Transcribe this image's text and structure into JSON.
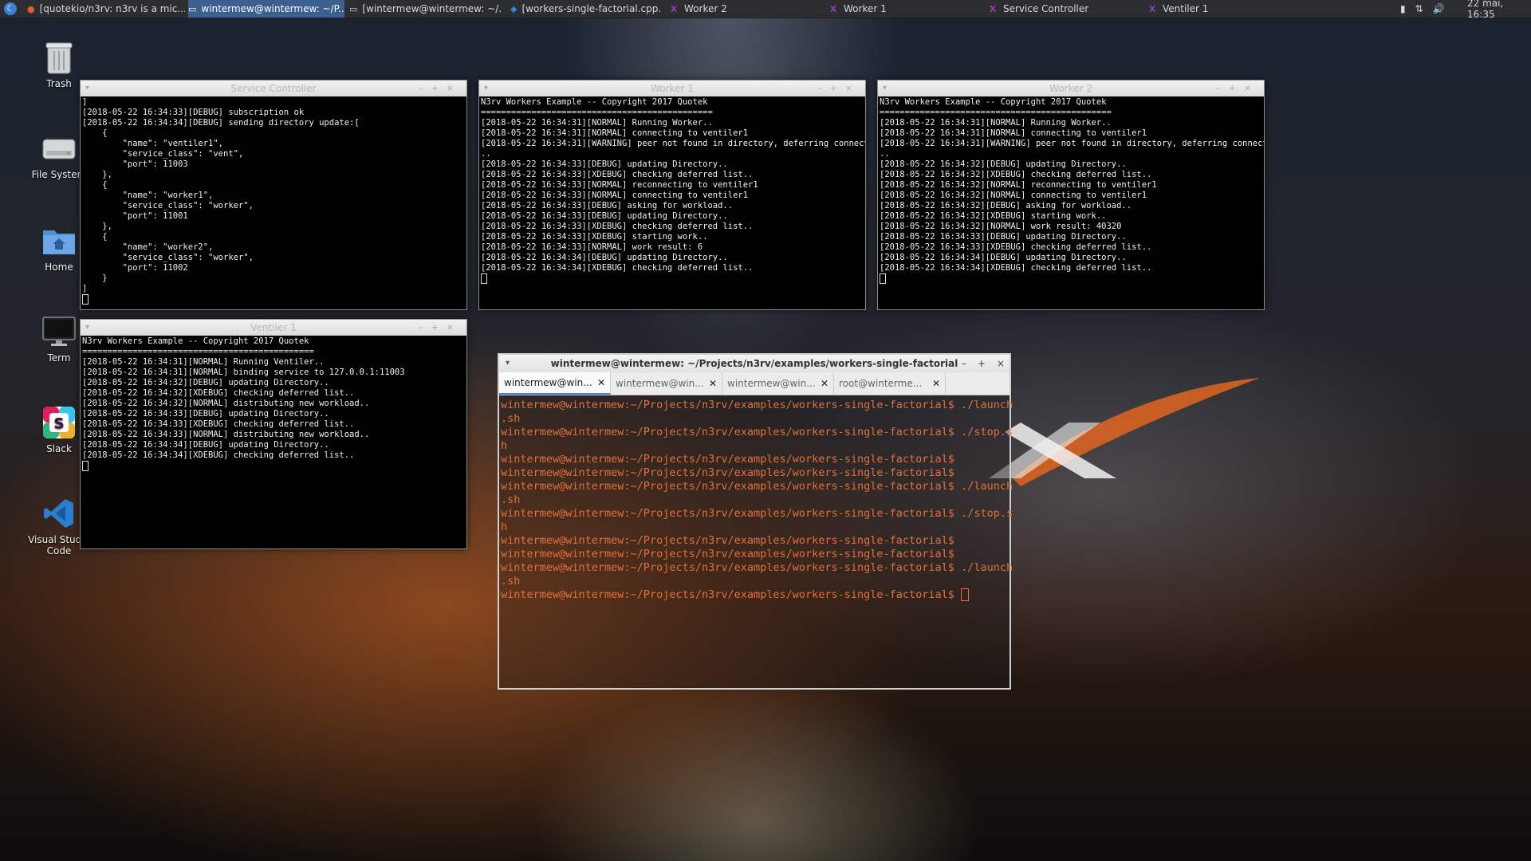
{
  "taskbar": {
    "tasks": [
      {
        "label": "[quotekio/n3rv: n3rv is a mic..."
      },
      {
        "label": "wintermew@wintermew: ~/P..."
      },
      {
        "label": "[wintermew@wintermew: ~/..."
      },
      {
        "label": "[workers-single-factorial.cpp..."
      },
      {
        "label": "Worker 2"
      },
      {
        "label": "Worker 1"
      },
      {
        "label": "Service Controller"
      },
      {
        "label": "Ventiler 1"
      }
    ],
    "clock": "22 mai, 16:35"
  },
  "desktop": {
    "icons": [
      {
        "label": "Trash"
      },
      {
        "label": "File System"
      },
      {
        "label": "Home"
      },
      {
        "label": "Term"
      },
      {
        "label": "Slack"
      },
      {
        "label": "Visual Studio Code"
      }
    ]
  },
  "windows": {
    "service_controller": {
      "title": "Service Controller",
      "text": "]\n[2018-05-22 16:34:33][DEBUG] subscription ok\n[2018-05-22 16:34:34][DEBUG] sending directory update:[\n    {\n        \"name\": \"ventiler1\",\n        \"service_class\": \"vent\",\n        \"port\": 11003\n    },\n    {\n        \"name\": \"worker1\",\n        \"service_class\": \"worker\",\n        \"port\": 11001\n    },\n    {\n        \"name\": \"worker2\",\n        \"service_class\": \"worker\",\n        \"port\": 11002\n    }\n]"
    },
    "worker1": {
      "title": "Worker 1",
      "text": "N3rv Workers Example -- Copyright 2017 Quotek\n==============================================\n[2018-05-22 16:34:31][NORMAL] Running Worker..\n[2018-05-22 16:34:31][NORMAL] connecting to ventiler1\n[2018-05-22 16:34:31][WARNING] peer not found in directory, deferring connection\n..\n[2018-05-22 16:34:33][DEBUG] updating Directory..\n[2018-05-22 16:34:33][XDEBUG] checking deferred list..\n[2018-05-22 16:34:33][NORMAL] reconnecting to ventiler1\n[2018-05-22 16:34:33][NORMAL] connecting to ventiler1\n[2018-05-22 16:34:33][DEBUG] asking for workload..\n[2018-05-22 16:34:33][DEBUG] updating Directory..\n[2018-05-22 16:34:33][XDEBUG] checking deferred list..\n[2018-05-22 16:34:33][XDEBUG] starting work..\n[2018-05-22 16:34:33][NORMAL] work result: 6\n[2018-05-22 16:34:34][DEBUG] updating Directory..\n[2018-05-22 16:34:34][XDEBUG] checking deferred list.."
    },
    "worker2": {
      "title": "Worker 2",
      "text": "N3rv Workers Example -- Copyright 2017 Quotek\n==============================================\n[2018-05-22 16:34:31][NORMAL] Running Worker..\n[2018-05-22 16:34:31][NORMAL] connecting to ventiler1\n[2018-05-22 16:34:31][WARNING] peer not found in directory, deferring connection\n..\n[2018-05-22 16:34:32][DEBUG] updating Directory..\n[2018-05-22 16:34:32][XDEBUG] checking deferred list..\n[2018-05-22 16:34:32][NORMAL] reconnecting to ventiler1\n[2018-05-22 16:34:32][NORMAL] connecting to ventiler1\n[2018-05-22 16:34:32][DEBUG] asking for workload..\n[2018-05-22 16:34:32][XDEBUG] starting work..\n[2018-05-22 16:34:32][NORMAL] work result: 40320\n[2018-05-22 16:34:33][DEBUG] updating Directory..\n[2018-05-22 16:34:33][XDEBUG] checking deferred list..\n[2018-05-22 16:34:34][DEBUG] updating Directory..\n[2018-05-22 16:34:34][XDEBUG] checking deferred list.."
    },
    "ventiler1": {
      "title": "Ventiler 1",
      "text": "N3rv Workers Example -- Copyright 2017 Quotek\n==============================================\n[2018-05-22 16:34:31][NORMAL] Running Ventiler..\n[2018-05-22 16:34:31][NORMAL] binding service to 127.0.0.1:11003\n[2018-05-22 16:34:32][DEBUG] updating Directory..\n[2018-05-22 16:34:32][XDEBUG] checking deferred list..\n[2018-05-22 16:34:32][NORMAL] distributing new workload..\n[2018-05-22 16:34:33][DEBUG] updating Directory..\n[2018-05-22 16:34:33][XDEBUG] checking deferred list..\n[2018-05-22 16:34:33][NORMAL] distributing new workload..\n[2018-05-22 16:34:34][DEBUG] updating Directory..\n[2018-05-22 16:34:34][XDEBUG] checking deferred list.."
    }
  },
  "main_terminal": {
    "title": "wintermew@wintermew: ~/Projects/n3rv/examples/workers-single-factorial",
    "tabs": [
      {
        "label": "wintermew@win..."
      },
      {
        "label": "wintermew@win..."
      },
      {
        "label": "wintermew@win..."
      },
      {
        "label": "root@winterme..."
      }
    ],
    "lines": [
      "wintermew@wintermew:~/Projects/n3rv/examples/workers-single-factorial$ ./launch",
      ".sh",
      "wintermew@wintermew:~/Projects/n3rv/examples/workers-single-factorial$ ./stop.s",
      "h",
      "wintermew@wintermew:~/Projects/n3rv/examples/workers-single-factorial$",
      "wintermew@wintermew:~/Projects/n3rv/examples/workers-single-factorial$",
      "wintermew@wintermew:~/Projects/n3rv/examples/workers-single-factorial$ ./launch",
      ".sh",
      "wintermew@wintermew:~/Projects/n3rv/examples/workers-single-factorial$ ./stop.s",
      "h",
      "wintermew@wintermew:~/Projects/n3rv/examples/workers-single-factorial$",
      "wintermew@wintermew:~/Projects/n3rv/examples/workers-single-factorial$",
      "wintermew@wintermew:~/Projects/n3rv/examples/workers-single-factorial$ ./launch",
      ".sh",
      "wintermew@wintermew:~/Projects/n3rv/examples/workers-single-factorial$ "
    ]
  },
  "colors": {
    "prompt": "#e2703a",
    "taskbar": "#2b2d31",
    "active_task": "#3b5f8f"
  }
}
